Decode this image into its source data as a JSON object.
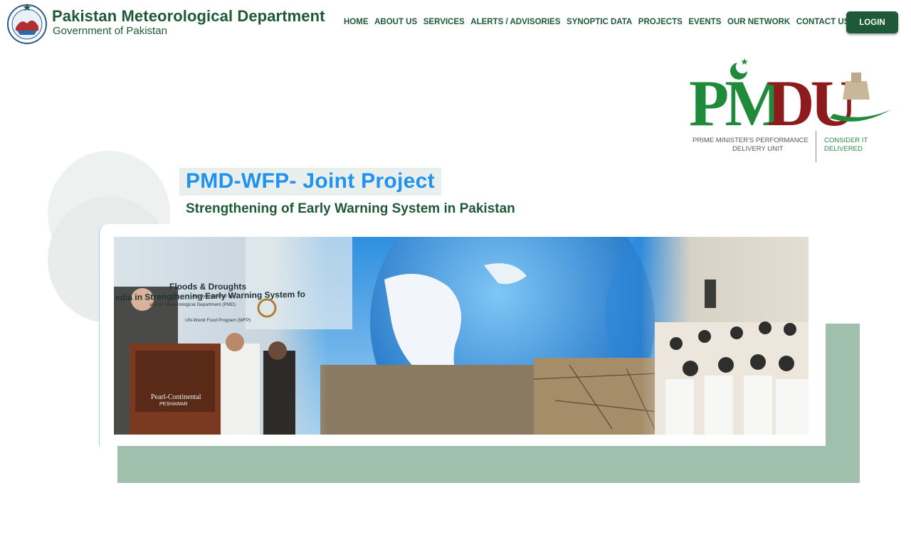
{
  "header": {
    "org_name": "Pakistan Meteorological Department",
    "org_sub": "Government of Pakistan",
    "emblem_icon": "pmd-emblem-icon"
  },
  "nav": {
    "items": [
      {
        "label": "HOME"
      },
      {
        "label": "ABOUT US"
      },
      {
        "label": "SERVICES"
      },
      {
        "label": "ALERTS / ADVISORIES"
      },
      {
        "label": "SYNOPTIC DATA"
      },
      {
        "label": "PROJECTS"
      },
      {
        "label": "EVENTS"
      },
      {
        "label": "OUR NETWORK"
      },
      {
        "label": "CONTACT US"
      }
    ],
    "login_label": "LOGIN"
  },
  "pmdu": {
    "logo_text": "PMDU",
    "line1": "PRIME MINISTER'S PERFORMANCE",
    "line2": "DELIVERY UNIT",
    "tag1": "CONSIDER IT",
    "tag2": "DELIVERED"
  },
  "project": {
    "title": "PMD-WFP- Joint Project",
    "subtitle": "Strengthening of Early Warning System in Pakistan"
  },
  "banner": {
    "line1": "edia in Strengthening Early Warning System fo",
    "line2": "Floods & Droughts",
    "line3": "Jointly organized by",
    "line4": "akistan Meteorological Department (PMD)",
    "line5": "UN-World Food Program (WFP)",
    "podium1": "Pearl-Continental",
    "podium2": "PESHAWAR"
  },
  "colors": {
    "brand_green": "#1e5a37",
    "title_blue": "#2192ee",
    "sage_block": "#a1bfad"
  }
}
